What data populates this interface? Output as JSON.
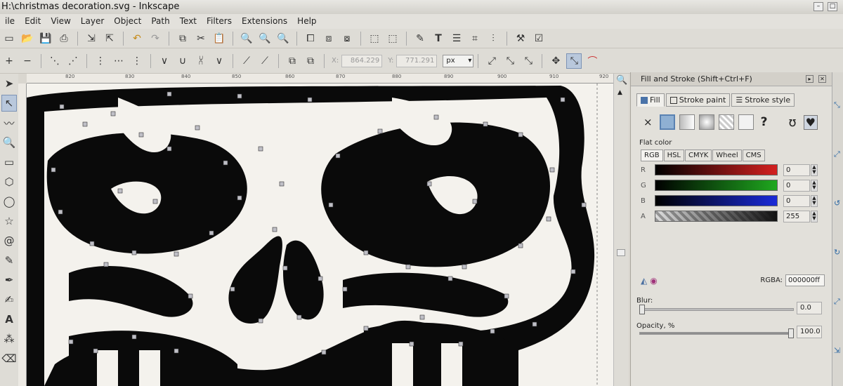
{
  "window": {
    "title": "H:\\christmas decoration.svg - Inkscape"
  },
  "menu": [
    "ile",
    "Edit",
    "View",
    "Layer",
    "Object",
    "Path",
    "Text",
    "Filters",
    "Extensions",
    "Help"
  ],
  "toolbar": {
    "x_label": "X:",
    "x_value": "864.229",
    "y_label": "Y:",
    "y_value": "771.291",
    "unit": "px"
  },
  "ruler_ticks": [
    "820",
    "830",
    "840",
    "850",
    "860",
    "870",
    "880",
    "890",
    "900",
    "910",
    "920"
  ],
  "panel": {
    "title": "Fill and Stroke (Shift+Ctrl+F)",
    "tabs": [
      "Fill",
      "Stroke paint",
      "Stroke style"
    ],
    "flat_color_label": "Flat color",
    "modes": [
      "RGB",
      "HSL",
      "CMYK",
      "Wheel",
      "CMS"
    ],
    "channels": [
      {
        "label": "R",
        "value": "0",
        "color": "#d42020"
      },
      {
        "label": "G",
        "value": "0",
        "color": "#1fa81f"
      },
      {
        "label": "B",
        "value": "0",
        "color": "#1a2ad8"
      },
      {
        "label": "A",
        "value": "255",
        "color": "#111111"
      }
    ],
    "rgba_label": "RGBA:",
    "rgba_value": "000000ff",
    "blur_label": "Blur:",
    "blur_value": "0.0",
    "opacity_label": "Opacity, %",
    "opacity_value": "100.0"
  },
  "icons": {
    "unknown_paint": "?",
    "no_paint": "×"
  }
}
